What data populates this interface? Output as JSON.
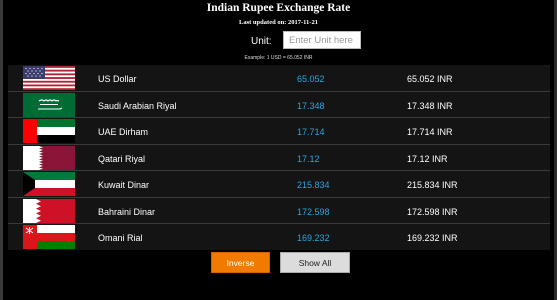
{
  "header": {
    "title": "Indian Rupee Exchange Rate",
    "last_updated": "Last updated on: 2017-11-21"
  },
  "unit": {
    "label": "Unit:",
    "placeholder": "Enter Unit here",
    "value": ""
  },
  "example": "Example: 1 USD = 65.052 INR",
  "rates": [
    {
      "currency": "US Dollar",
      "rate": "65.052",
      "inr": "65.052 INR",
      "flag": "usa-flag-icon"
    },
    {
      "currency": "Saudi Arabian Riyal",
      "rate": "17.348",
      "inr": "17.348 INR",
      "flag": "saudi-flag-icon"
    },
    {
      "currency": "UAE Dirham",
      "rate": "17.714",
      "inr": "17.714 INR",
      "flag": "uae-flag-icon"
    },
    {
      "currency": "Qatari Riyal",
      "rate": "17.12",
      "inr": "17.12 INR",
      "flag": "qatar-flag-icon"
    },
    {
      "currency": "Kuwait Dinar",
      "rate": "215.834",
      "inr": "215.834 INR",
      "flag": "kuwait-flag-icon"
    },
    {
      "currency": "Bahraini Dinar",
      "rate": "172.598",
      "inr": "172.598 INR",
      "flag": "bahrain-flag-icon"
    },
    {
      "currency": "Omani Rial",
      "rate": "169.232",
      "inr": "169.232 INR",
      "flag": "oman-flag-icon"
    }
  ],
  "buttons": {
    "inverse": "Inverse",
    "show_all": "Show All"
  },
  "colors": {
    "rate_text": "#29a5e3",
    "inverse_button": "#f07b00",
    "show_all_button": "#dcdcdc"
  }
}
